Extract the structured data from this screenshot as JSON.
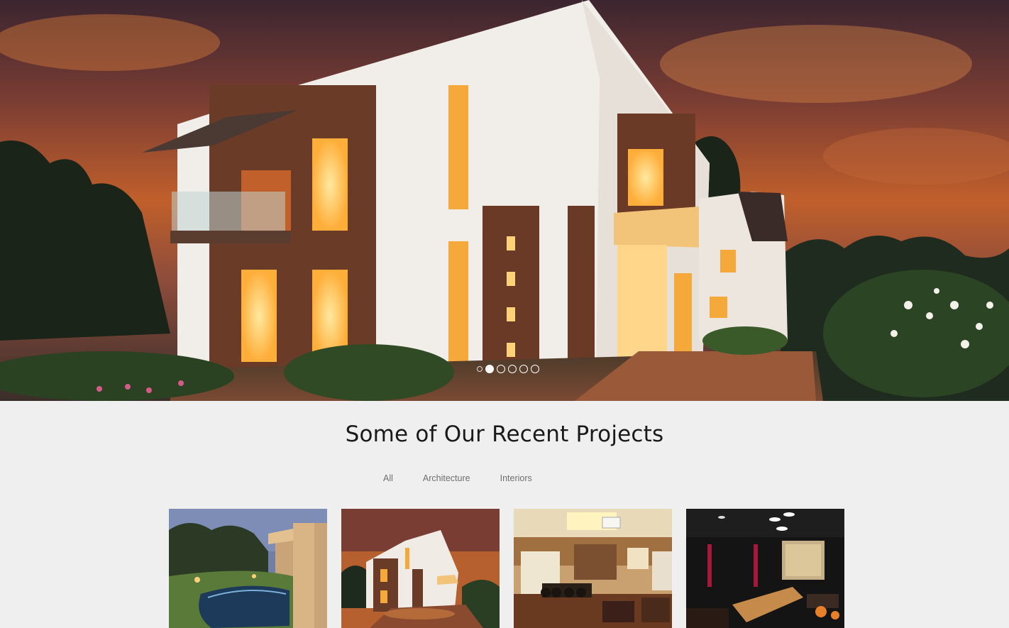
{
  "hero": {
    "slide_count": 5,
    "active_slide": 1
  },
  "projects": {
    "title": "Some of Our Recent Projects",
    "filters": [
      "All",
      "Architecture",
      "Interiors"
    ],
    "tiles": [
      {
        "subject": "pool-villa-dusk"
      },
      {
        "subject": "white-house-sunset"
      },
      {
        "subject": "office-interior"
      },
      {
        "subject": "bar-lounge-interior"
      }
    ]
  },
  "colors": {
    "background": "#efefef",
    "title": "#1a1a1a",
    "filter_text": "#6f6f6f",
    "dot": "#ffffff"
  }
}
